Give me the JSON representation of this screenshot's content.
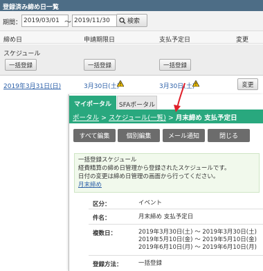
{
  "header": {
    "title": "登録済み締め日一覧"
  },
  "period": {
    "label": "期間：",
    "from": "2019/03/01",
    "tilde": "〜",
    "to": "2019/11/30",
    "search_label": "検索"
  },
  "table": {
    "columns": [
      "締め日",
      "申請期限日",
      "支払予定日",
      "変更"
    ],
    "schedule_label": "スケジュール",
    "bulk_label": "一括登録",
    "row": {
      "closing": "2019年3月31日(日)",
      "deadline": "3月30日(土)",
      "payment": "3月30日(土)",
      "change_label": "変更"
    }
  },
  "popup": {
    "tabs": [
      "マイポータル",
      "SFAポータル"
    ],
    "breadcrumb": {
      "portal": "ポータル",
      "sep": ">",
      "schedule_list": "スケジュール(一覧)",
      "current": "月末締め 支払予定日"
    },
    "actions": [
      "すべて編集",
      "個別編集",
      "メール通知",
      "閉じる"
    ],
    "info": {
      "title": "一括登録スケジュール",
      "line1": "経費精算の締め日管理から登録されたスケジュールです。",
      "line2": "日付の変更は締め日管理の画面から行ってください。",
      "link": "月末締め"
    },
    "details": [
      {
        "label": "区分：",
        "value": [
          "イベント"
        ]
      },
      {
        "label": "件名：",
        "value": [
          "月末締め 支払予定日"
        ]
      },
      {
        "label": "複数日：",
        "value": [
          "2019年3月30日(土) 〜 2019年3月30日(土)",
          "2019年5月10日(金) 〜 2019年5月10日(金)",
          "2019年6月10日(月) 〜 2019年6月10日(月)"
        ]
      },
      {
        "label": "登録方法：",
        "value": [
          "一括登録"
        ]
      }
    ]
  },
  "colors": {
    "header_bg": "#4d6d86",
    "accent_green": "#29a87e",
    "link_blue": "#2b5fa8",
    "arrow_red": "#e0202a"
  }
}
